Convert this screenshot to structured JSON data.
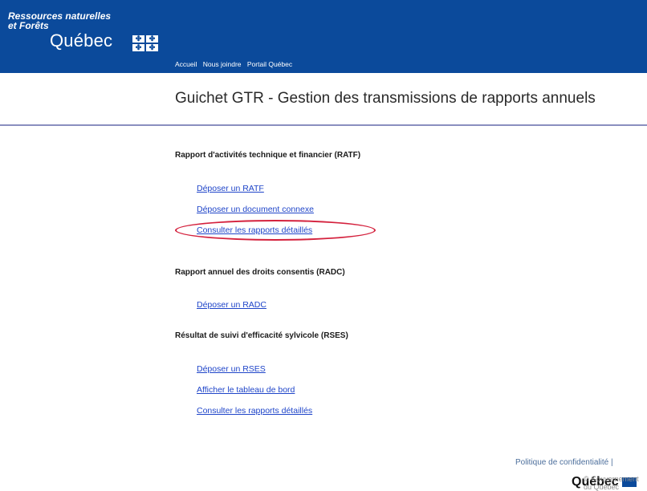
{
  "header": {
    "ministry": "Ressources naturelles et Forêts",
    "ministry_line1": "Ressources naturelles",
    "ministry_line2": "et Forêts",
    "quebec_word": "Québec",
    "nav": [
      "Accueil",
      "Nous joindre",
      "Portail Québec"
    ],
    "colors": {
      "brand": "#0b4a9b",
      "text": "#ffffff"
    },
    "flag_icon": "fleur-de-lis-flag-icon"
  },
  "main": {
    "title": "Guichet GTR - Gestion des transmissions de rapports annuels",
    "sections": [
      {
        "heading": "Rapport d'activités technique et financier (RATF)",
        "links": [
          "Déposer un RATF",
          "Déposer un document connexe",
          "Consulter les rapports détaillés"
        ]
      },
      {
        "heading": "Rapport annuel des droits consentis (RADC)",
        "links": [
          "Déposer un RADC"
        ]
      },
      {
        "heading": "Résultat de suivi d'efficacité sylvicole (RSES)",
        "links": [
          "Déposer un RSES",
          "Afficher le tableau de bord",
          "Consulter les rapports détaillés"
        ]
      }
    ],
    "colors": {
      "link": "#1f45c9",
      "divider": "#8a8fbf",
      "highlight": "#d4213d"
    }
  },
  "footer": {
    "policy": "Politique de confidentialité",
    "separator": "|",
    "logo": "Québec",
    "copyright": "© Gouvernement du Québec"
  }
}
